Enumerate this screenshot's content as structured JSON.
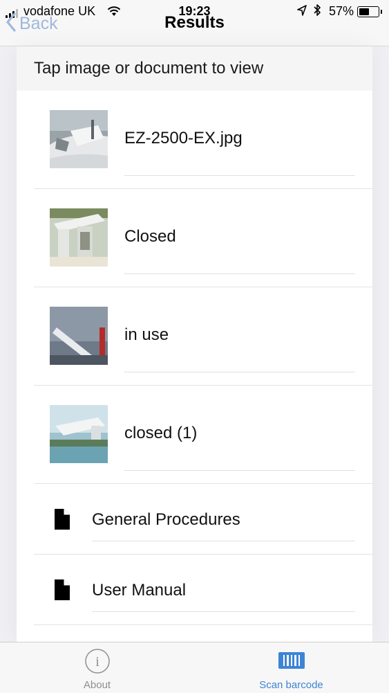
{
  "status_bar": {
    "carrier": "vodafone UK",
    "time": "19:23",
    "battery": "57%",
    "battery_level": 0.57
  },
  "nav": {
    "back_label": "Back",
    "title": "Results"
  },
  "hint": "Tap image or document to view",
  "images": [
    {
      "label": "EZ-2500-EX.jpg",
      "thumb": "boat-deck"
    },
    {
      "label": "Closed",
      "thumb": "crane-closed"
    },
    {
      "label": "in use",
      "thumb": "crane-in-use"
    },
    {
      "label": "closed (1)",
      "thumb": "crane-closed-water"
    }
  ],
  "documents": [
    {
      "label": "General Procedures",
      "icon": "document-icon"
    },
    {
      "label": "User Manual",
      "icon": "document-icon"
    }
  ],
  "tabbar": {
    "about_label": "About",
    "scan_label": "Scan barcode"
  },
  "colors": {
    "accent": "#3d84d6",
    "back_tint": "#9fb8dc",
    "inactive_tab": "#8e8e93"
  }
}
